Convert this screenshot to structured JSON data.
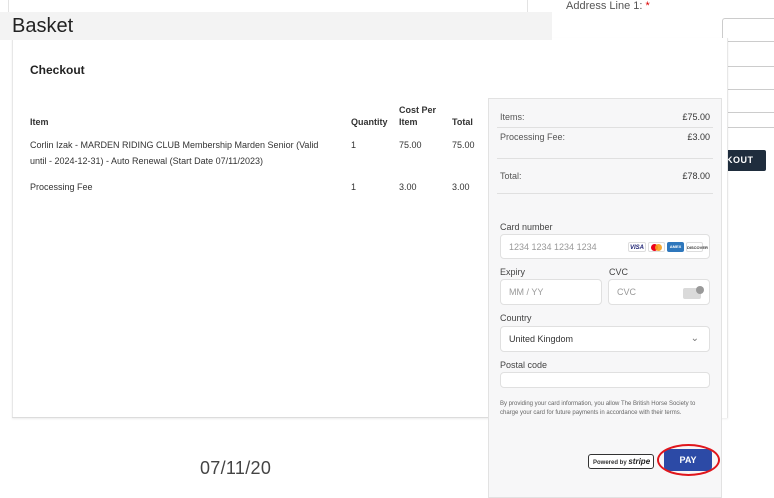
{
  "background": {
    "address_label": "Address Line 1:",
    "required_mark": "*",
    "checkout_button_label": "KOUT",
    "date_text": "07/11/20"
  },
  "basket": {
    "title": "Basket",
    "checkout_title": "Checkout",
    "columns": {
      "item": "Item",
      "quantity": "Quantity",
      "cost_per_line1": "Cost Per",
      "cost_per_line2": "Item",
      "total": "Total"
    },
    "rows": [
      {
        "item_line1": "Corlin Izak - MARDEN RIDING CLUB Membership Marden Senior (Valid",
        "item_line2": "until - 2024-12-31) - Auto Renewal (Start Date 07/11/2023)",
        "quantity": "1",
        "cost": "75.00",
        "total": "75.00"
      },
      {
        "item_line1": "Processing Fee",
        "item_line2": "",
        "quantity": "1",
        "cost": "3.00",
        "total": "3.00"
      }
    ]
  },
  "payment": {
    "items_label": "Items:",
    "items_value": "£75.00",
    "fee_label": "Processing Fee:",
    "fee_value": "£3.00",
    "total_label": "Total:",
    "total_value": "£78.00",
    "card_number_label": "Card number",
    "card_number_placeholder": "1234 1234 1234 1234",
    "card_brands": [
      "VISA",
      "",
      "AMEX",
      "DISCOVER"
    ],
    "expiry_label": "Expiry",
    "expiry_placeholder": "MM / YY",
    "cvc_label": "CVC",
    "cvc_placeholder": "CVC",
    "country_label": "Country",
    "country_value": "United Kingdom",
    "postal_label": "Postal code",
    "postal_value": "",
    "consent_text": "By providing your card information, you allow The British Horse Society to charge your card for future payments in accordance with their terms.",
    "powered_by": "Powered by",
    "stripe_word": "stripe",
    "pay_label": "PAY"
  },
  "colors": {
    "pay_button": "#2c4aa6",
    "highlight_ring": "#e0161c",
    "dark_button": "#1f2d3d"
  }
}
